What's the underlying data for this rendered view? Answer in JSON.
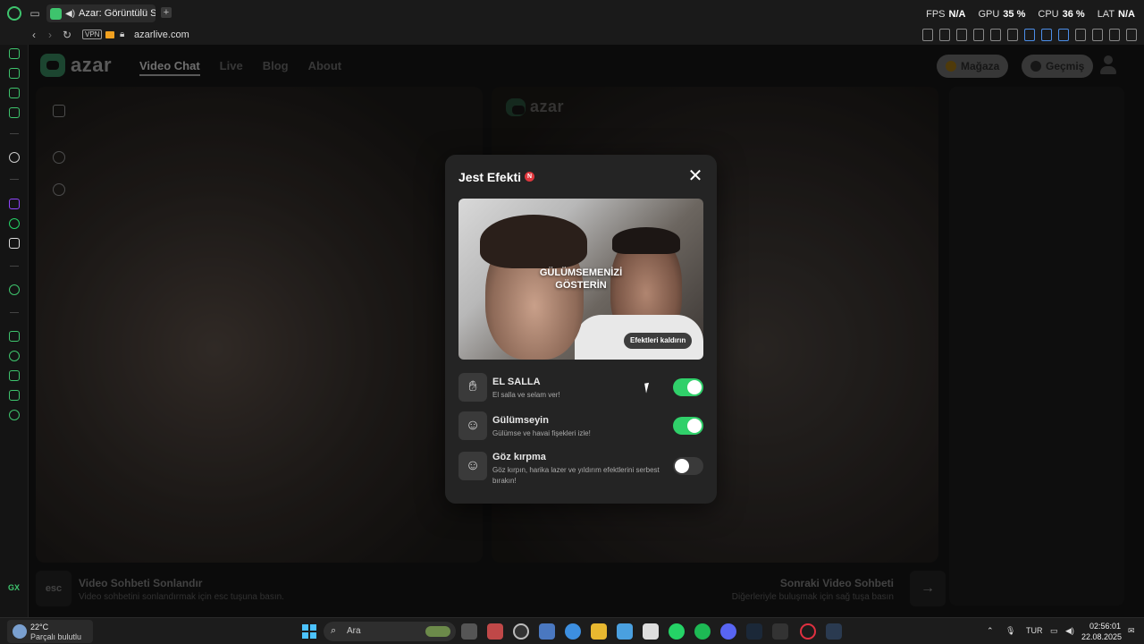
{
  "browser": {
    "tab_title": "Azar: Görüntülü Sohbet",
    "url": "azarlive.com",
    "vpn_label": "VPN",
    "stats": [
      {
        "label": "FPS",
        "value": "N/A"
      },
      {
        "label": "GPU",
        "value": "35 %"
      },
      {
        "label": "CPU",
        "value": "36 %"
      },
      {
        "label": "LAT",
        "value": "N/A"
      }
    ],
    "sidebar_gx": "GX"
  },
  "site": {
    "logo_text": "azar",
    "nav": [
      "Video Chat",
      "Live",
      "Blog",
      "About"
    ],
    "active_nav": "Video Chat",
    "store_label": "Mağaza",
    "history_label": "Geçmiş"
  },
  "video": {
    "remote_logo_text": "azar"
  },
  "bottom": {
    "esc_key": "esc",
    "end_title": "Video Sohbeti Sonlandır",
    "end_sub": "Video sohbetini sonlandırmak için esc tuşuna basın.",
    "next_title": "Sonraki Video Sohbeti",
    "next_sub": "Diğerleriyle buluşmak için sağ tuşa basın",
    "arrow_key": "→"
  },
  "modal": {
    "title": "Jest Efekti",
    "new_badge": "N",
    "preview_text_line1": "GÜLÜMSEMENİZİ",
    "preview_text_line2": "GÖSTERİN",
    "remove_effects": "Efektleri kaldırın",
    "gestures": [
      {
        "name": "EL SALLA",
        "desc": "El salla ve selam ver!",
        "enabled": true,
        "icon": "wave-hand-icon"
      },
      {
        "name": "Gülümseyin",
        "desc": "Gülümse ve havai fişekleri izle!",
        "enabled": true,
        "icon": "smile-icon"
      },
      {
        "name": "Göz kırpma",
        "desc": "Göz kırpın, harika lazer ve yıldırım efektlerini serbest bırakın!",
        "enabled": false,
        "icon": "smile-icon"
      }
    ]
  },
  "taskbar": {
    "temperature": "22°C",
    "weather_desc": "Parçalı bulutlu",
    "search_placeholder": "Ara",
    "language": "TUR",
    "time": "02:56:01",
    "date": "22.08.2025"
  },
  "colors": {
    "accent_green": "#30d06a",
    "opera_gx_green": "#3ec46d",
    "badge_red": "#e0383e"
  }
}
